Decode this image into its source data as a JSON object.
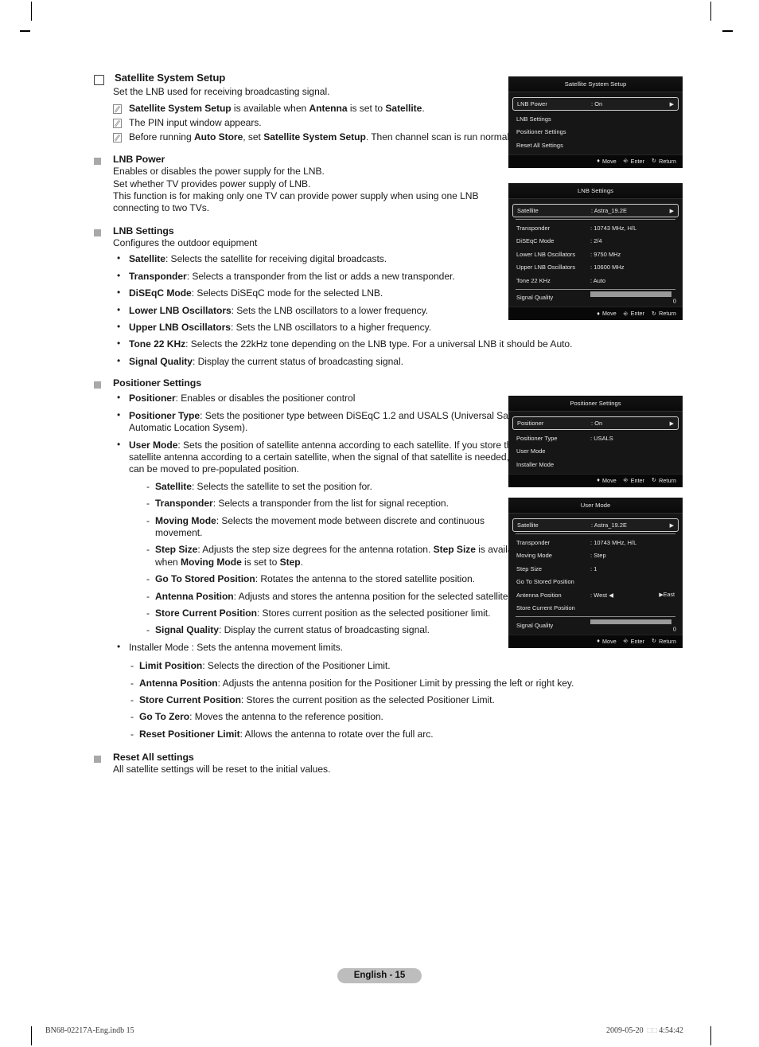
{
  "page": {
    "badge": "English - 15",
    "footer_left": "BN68-02217A-Eng.indb   15",
    "footer_right_date": "2009-05-20",
    "footer_right_marks": "□□",
    "footer_right_time": "4:54:42"
  },
  "sections": {
    "satellite_system_setup": {
      "title": "Satellite System Setup",
      "intro": "Set the LNB used for receiving broadcasting signal.",
      "notes": [
        "Satellite System Setup is available when Antenna is set to Satellite.",
        "The PIN input window appears.",
        "Before running Auto Store, set Satellite System Setup. Then channel scan is run normally."
      ]
    },
    "lnb_power": {
      "title": "LNB Power",
      "lines": [
        "Enables or disables the power supply for the LNB.",
        "Set whether TV provides power supply of LNB.",
        "This function is for making only one TV can provide power supply when using one LNB connecting to two TVs."
      ]
    },
    "lnb_settings": {
      "title": "LNB Settings",
      "intro": "Configures the outdoor equipment",
      "items": [
        {
          "term": "Satellite",
          "desc": ": Selects the satellite for receiving digital broadcasts."
        },
        {
          "term": "Transponder",
          "desc": ": Selects a transponder from the list or adds a new transponder."
        },
        {
          "term": "DiSEqC Mode",
          "desc": ": Selects DiSEqC mode for the selected LNB."
        },
        {
          "term": "Lower LNB Oscillators",
          "desc": ": Sets the LNB oscillators to a lower frequency."
        },
        {
          "term": "Upper LNB Oscillators",
          "desc": ": Sets the LNB oscillators to a higher frequency."
        },
        {
          "term": "Tone 22 KHz",
          "desc": ": Selects the 22kHz tone depending on the LNB type. For a universal LNB it should be Auto."
        },
        {
          "term": "Signal Quality",
          "desc": ": Display the current status of broadcasting signal."
        }
      ]
    },
    "positioner_settings": {
      "title": "Positioner Settings",
      "positioner": {
        "term": "Positioner",
        "desc": ": Enables or disables the positioner control"
      },
      "positioner_type": {
        "term": "Positioner Type",
        "desc": ": Sets the positioner type between DiSEqC 1.2 and USALS (Universal Satellite Automatic Location Sysem)."
      },
      "user_mode": {
        "term": "User Mode",
        "desc": ": Sets the position of satellite antenna according to each satellite. If you store the current position of satellite antenna according to a certain satellite, when the signal of that satellite is needed, the satellite antenna can be moved to pre-populated position.",
        "subitems": [
          {
            "term": "Satellite",
            "desc": ": Selects the satellite to set the position for."
          },
          {
            "term": "Transponder",
            "desc": ": Selects a transponder from the list for signal reception."
          },
          {
            "term": "Moving Mode",
            "desc": ": Selects the movement mode between discrete and continuous movement."
          },
          {
            "term": "Step Size",
            "desc": ": Adjusts the step size degrees for the antenna rotation. Step Size is available when Moving Mode is set to Step."
          },
          {
            "term": "Go To Stored Position",
            "desc": ": Rotates the antenna to the stored satellite position."
          },
          {
            "term": "Antenna Position",
            "desc": ": Adjusts and stores the antenna position for the selected satellite."
          },
          {
            "term": "Store Current Position",
            "desc": ": Stores current position as the selected positioner limit."
          },
          {
            "term": "Signal Quality",
            "desc": ": Display the current status of broadcasting signal."
          }
        ]
      },
      "installer_mode": {
        "text": "Installer Mode : Sets the antenna movement limits.",
        "subitems": [
          {
            "term": "Limit Position",
            "desc": ": Selects the direction of the Positioner Limit."
          },
          {
            "term": "Antenna Position",
            "desc": ": Adjusts the antenna position for the Positioner Limit by pressing the left or right key."
          },
          {
            "term": "Store Current Position",
            "desc": ": Stores the current position as the selected Positioner Limit."
          },
          {
            "term": "Go To Zero",
            "desc": ": Moves the antenna to the reference position."
          },
          {
            "term": "Reset Positioner Limit",
            "desc": ": Allows the antenna to rotate over the full arc."
          }
        ]
      }
    },
    "reset_all_settings": {
      "title": "Reset All settings",
      "line": "All satellite settings will be reset to the initial values."
    }
  },
  "osd_footer": {
    "move": "Move",
    "enter": "Enter",
    "return": "Return",
    "move_icon": "up-down-arrow-icon",
    "enter_icon": "enter-key-icon",
    "return_icon": "return-arrow-icon"
  },
  "osd_panels": {
    "satellite_system_setup": {
      "title": "Satellite System Setup",
      "rows": [
        {
          "label": "LNB Power",
          "value": ": On",
          "selected": true,
          "arrow": "▶"
        },
        {
          "label": "LNB Settings",
          "value": "",
          "selected": false
        },
        {
          "label": "Positioner Settings",
          "value": "",
          "selected": false
        },
        {
          "label": "Reset All Settings",
          "value": "",
          "selected": false
        }
      ]
    },
    "lnb_settings": {
      "title": "LNB Settings",
      "rows": [
        {
          "label": "Satellite",
          "value": ": Astra_19.2E",
          "selected": true,
          "arrow": "▶"
        },
        {
          "label": "Transponder",
          "value": ": 10743 MHz, H/L",
          "selected": false
        },
        {
          "label": "DiSEqC Mode",
          "value": ": 2/4",
          "selected": false
        },
        {
          "label": "Lower LNB Oscillators",
          "value": ": 9750 MHz",
          "selected": false
        },
        {
          "label": "Upper LNB Oscillators",
          "value": ": 10600 MHz",
          "selected": false
        },
        {
          "label": "Tone 22 KHz",
          "value": ": Auto",
          "selected": false
        }
      ],
      "signal_quality": {
        "label": "Signal Quality",
        "value": "0"
      }
    },
    "positioner_settings": {
      "title": "Positioner Settings",
      "rows": [
        {
          "label": "Positioner",
          "value": ": On",
          "selected": true,
          "arrow": "▶"
        },
        {
          "label": "Positioner Type",
          "value": ": USALS",
          "selected": false
        },
        {
          "label": "User Mode",
          "value": "",
          "selected": false
        },
        {
          "label": "Installer Mode",
          "value": "",
          "selected": false
        }
      ]
    },
    "user_mode": {
      "title": "User Mode",
      "rows": [
        {
          "label": "Satellite",
          "value": ": Astra_19.2E",
          "selected": true,
          "arrow": "▶"
        },
        {
          "label": "Transponder",
          "value": ": 10743 MHz, H/L",
          "selected": false
        },
        {
          "label": "Moving Mode",
          "value": ": Step",
          "selected": false
        },
        {
          "label": "Step Size",
          "value": ": 1",
          "selected": false
        },
        {
          "label": "Go To Stored Position",
          "value": "",
          "selected": false
        }
      ],
      "antenna_position": {
        "label": "Antenna Position",
        "west": ": West ◀",
        "east": "▶East"
      },
      "store_row": {
        "label": "Store Current Position"
      },
      "signal_quality": {
        "label": "Signal Quality",
        "value": "0"
      }
    }
  }
}
